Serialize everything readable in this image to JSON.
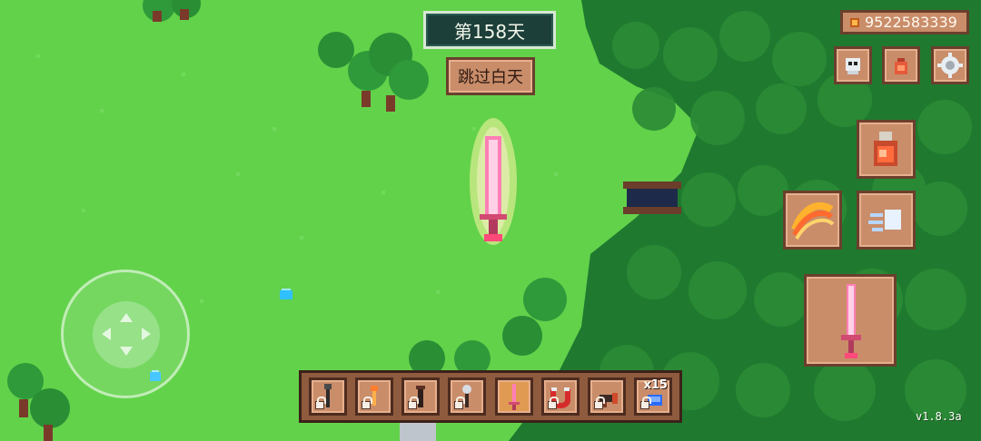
{
  "hud": {
    "day_label": "第158天",
    "skip_day_label": "跳过白天",
    "coins": "9522583339",
    "version": "v1.8.3a"
  },
  "hotbar": {
    "items": [
      {
        "icon": "dark-wand-icon",
        "locked": true,
        "selected": false
      },
      {
        "icon": "brush-icon",
        "locked": true,
        "selected": false
      },
      {
        "icon": "dark-rod-icon",
        "locked": true,
        "selected": false
      },
      {
        "icon": "scepter-icon",
        "locked": true,
        "selected": false
      },
      {
        "icon": "pink-sword-icon",
        "locked": false,
        "selected": true
      },
      {
        "icon": "horseshoe-magnet-icon",
        "locked": true,
        "selected": false
      },
      {
        "icon": "cannon-icon",
        "locked": true,
        "selected": false
      },
      {
        "icon": "blue-gem-icon",
        "locked": true,
        "selected": false,
        "count": "x15"
      }
    ]
  },
  "buttons": {
    "top_row": [
      "skull-icon",
      "bag-icon",
      "gear-icon"
    ],
    "ability_1": "potion-icon",
    "ability_2": "claw-slash-icon",
    "ability_3": "dash-icon",
    "weapon": "pink-sword-icon"
  },
  "colors": {
    "grass": "#62d24a",
    "forest_dark": "#1d6b2a",
    "panel_wood": "#c98d6a",
    "panel_border": "#6a3f2c",
    "day_panel": "#1d3f3a"
  }
}
